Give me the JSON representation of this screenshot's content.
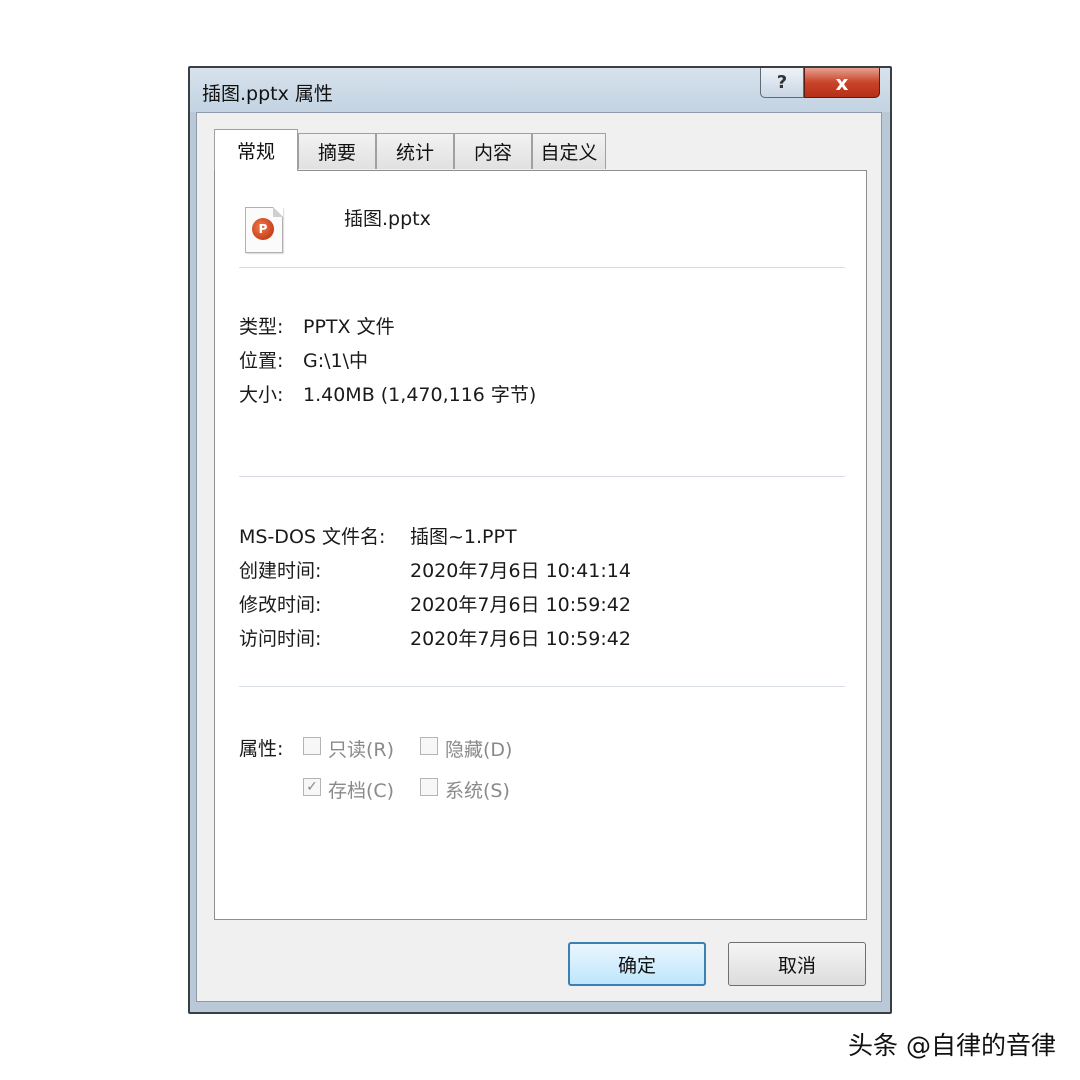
{
  "window": {
    "title": "插图.pptx 属性",
    "help_label": "?",
    "close_label": "x"
  },
  "tabs": [
    {
      "label": "常规",
      "active": true
    },
    {
      "label": "摘要"
    },
    {
      "label": "统计"
    },
    {
      "label": "内容"
    },
    {
      "label": "自定义"
    }
  ],
  "general": {
    "file_icon_letter": "P",
    "filename": "插图.pptx",
    "type_label": "类型:",
    "type_value": "PPTX 文件",
    "location_label": "位置:",
    "location_value": "G:\\1\\中",
    "size_label": "大小:",
    "size_value": "1.40MB (1,470,116 字节)",
    "msdos_label": "MS-DOS 文件名:",
    "msdos_value": "插图~1.PPT",
    "created_label": "创建时间:",
    "created_value": "2020年7月6日 10:41:14",
    "modified_label": "修改时间:",
    "modified_value": "2020年7月6日 10:59:42",
    "accessed_label": "访问时间:",
    "accessed_value": "2020年7月6日 10:59:42",
    "attributes_label": "属性:",
    "attributes": {
      "readonly": {
        "label": "只读(R)",
        "checked": false
      },
      "hidden": {
        "label": "隐藏(D)",
        "checked": false
      },
      "archive": {
        "label": "存档(C)",
        "checked": true
      },
      "system": {
        "label": "系统(S)",
        "checked": false
      }
    },
    "check_mark": "✓"
  },
  "buttons": {
    "ok": "确定",
    "cancel": "取消"
  },
  "watermark": "头条 @自律的音律"
}
